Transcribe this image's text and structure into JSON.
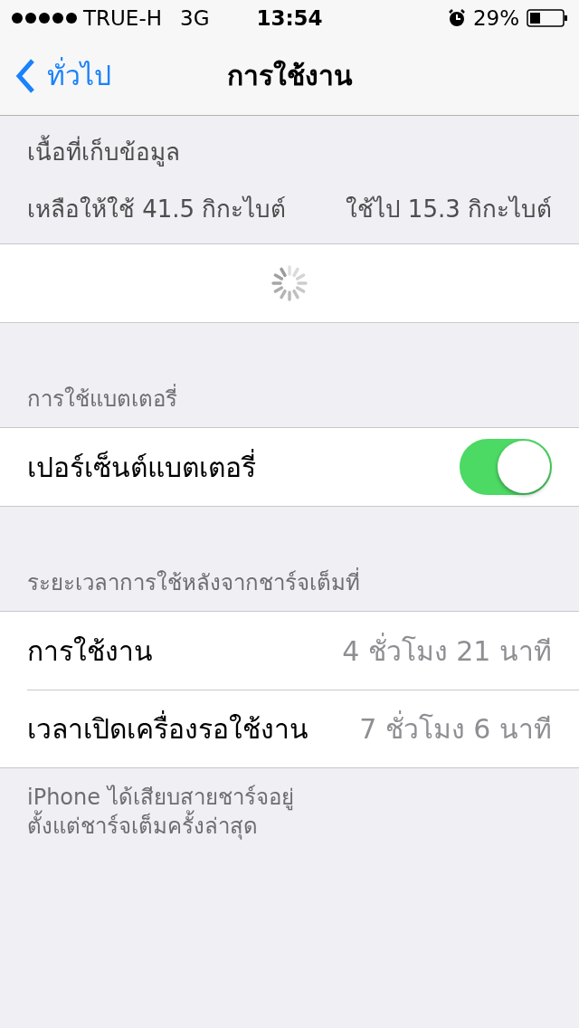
{
  "status_bar": {
    "carrier": "TRUE-H",
    "network": "3G",
    "time": "13:54",
    "battery_percent": "29%"
  },
  "nav": {
    "back": "ทั่วไป",
    "title": "การใช้งาน"
  },
  "storage": {
    "header": "เนื้อที่เก็บข้อมูล",
    "available": "เหลือให้ใช้ 41.5 กิกะไบต์",
    "used": "ใช้ไป 15.3 กิกะไบต์",
    "loading": true
  },
  "battery_section": {
    "header": "การใช้แบตเตอรี่",
    "rows": [
      {
        "label": "เปอร์เซ็นต์แบตเตอรี่",
        "on": true
      }
    ]
  },
  "time_section": {
    "header": "ระยะเวลาการใช้หลังจากชาร์จเต็มที่",
    "rows": [
      {
        "label": "การใช้งาน",
        "value": "4 ชั่วโมง 21 นาที"
      },
      {
        "label": "เวลาเปิดเครื่องรอใช้งาน",
        "value": "7 ชั่วโมง 6 นาที"
      }
    ],
    "footer": [
      "iPhone ได้เสียบสายชาร์จอยู่",
      "ตั้งแต่ชาร์จเต็มครั้งล่าสุด"
    ]
  }
}
